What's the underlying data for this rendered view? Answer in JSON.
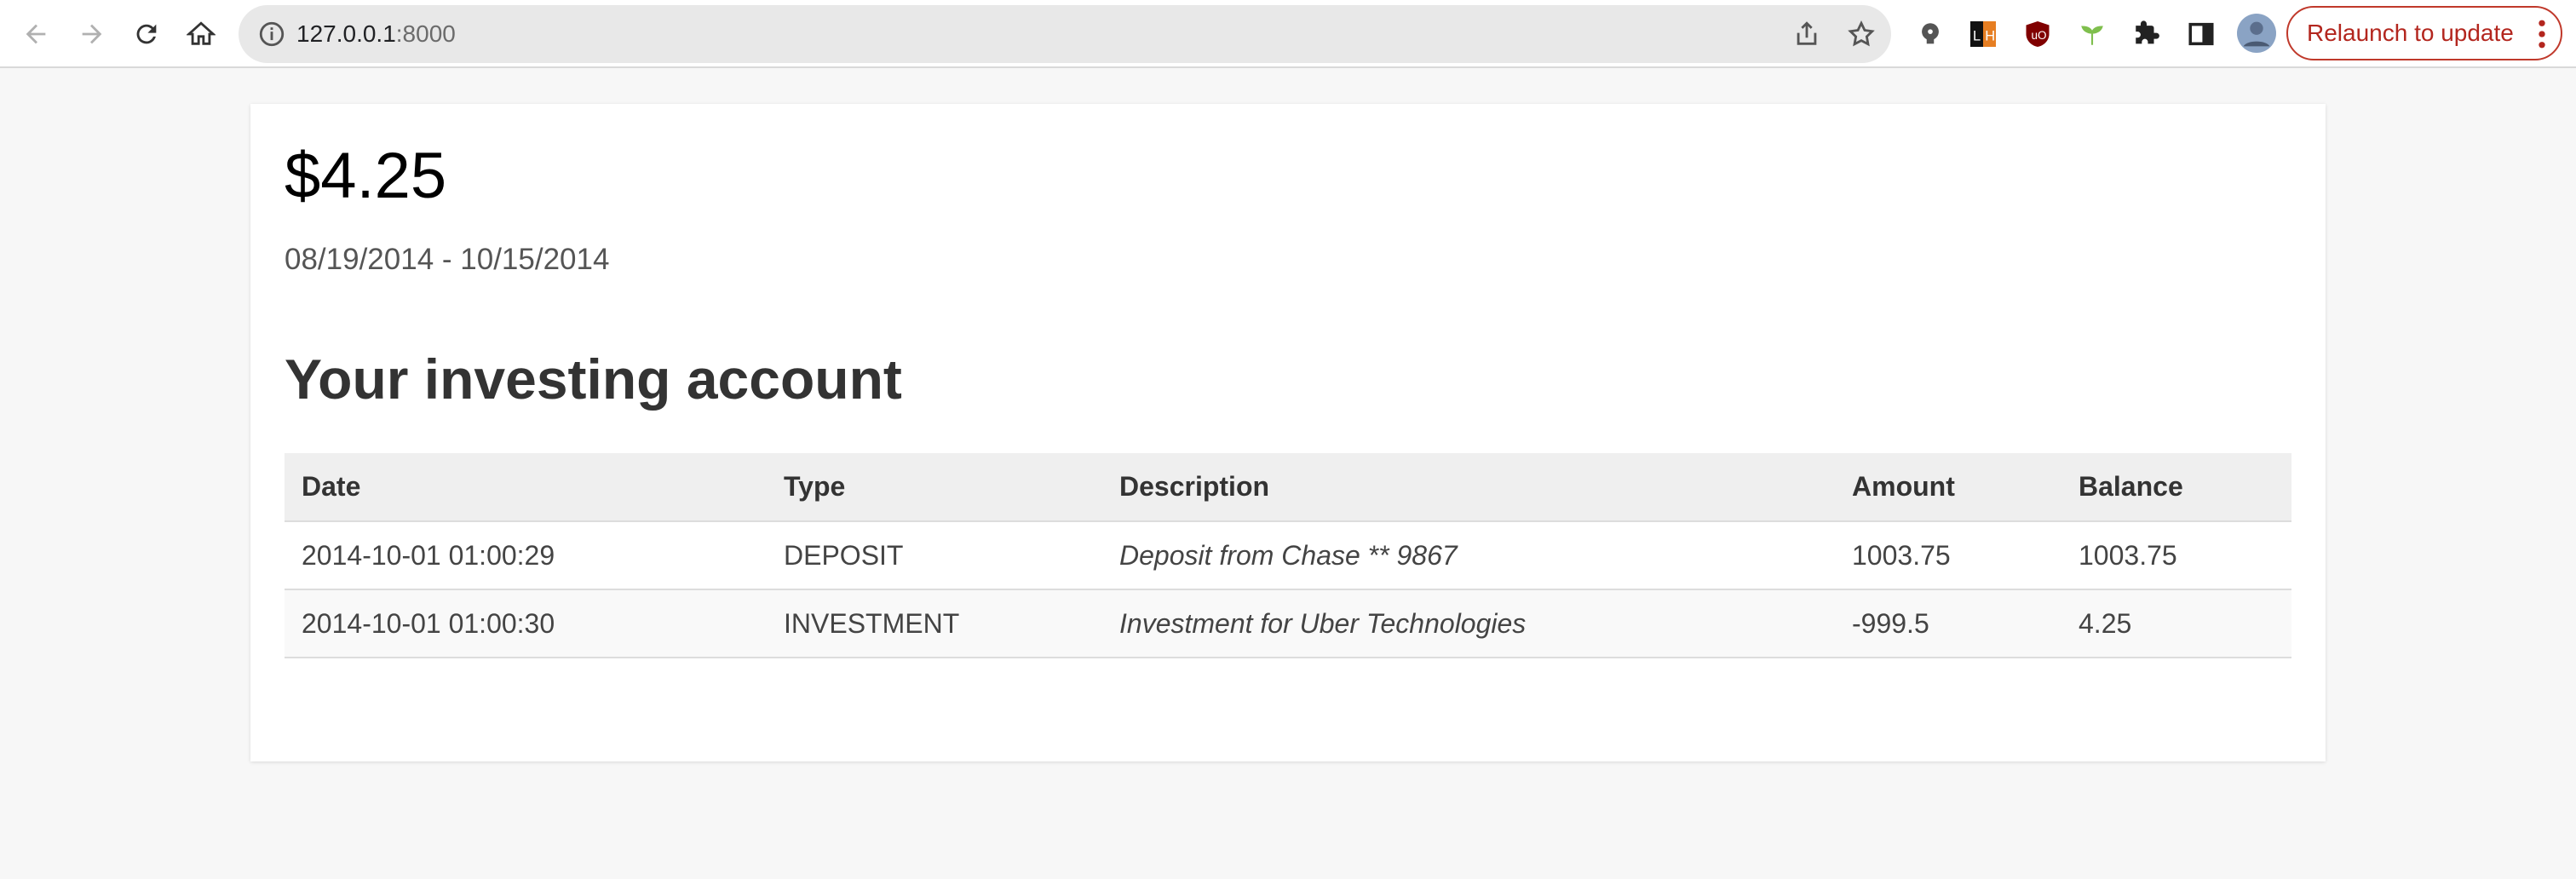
{
  "browser": {
    "url_host": "127.0.0.1",
    "url_port": ":8000",
    "relaunch_label": "Relaunch to update",
    "nav": [
      "back-icon",
      "forward-icon",
      "reload-icon",
      "home-icon"
    ],
    "extensions": [
      "bulb-extension-icon",
      "lh-extension-icon",
      "ublock-extension-icon",
      "plant-extension-icon",
      "puzzle-extensions-icon",
      "side-panel-icon",
      "profile-avatar"
    ]
  },
  "account": {
    "balance": "$4.25",
    "date_range": "08/19/2014 - 10/15/2014",
    "heading": "Your investing account"
  },
  "table": {
    "headers": [
      "Date",
      "Type",
      "Description",
      "Amount",
      "Balance"
    ],
    "rows": [
      {
        "date": "2014-10-01 01:00:29",
        "type": "DEPOSIT",
        "description": "Deposit from Chase ** 9867",
        "amount": "1003.75",
        "balance": "1003.75"
      },
      {
        "date": "2014-10-01 01:00:30",
        "type": "INVESTMENT",
        "description": "Investment for Uber Technologies",
        "amount": "-999.5",
        "balance": "4.25"
      }
    ]
  },
  "colors": {
    "page_bg": "#f7f7f7",
    "relaunch_accent": "#b3261e"
  }
}
